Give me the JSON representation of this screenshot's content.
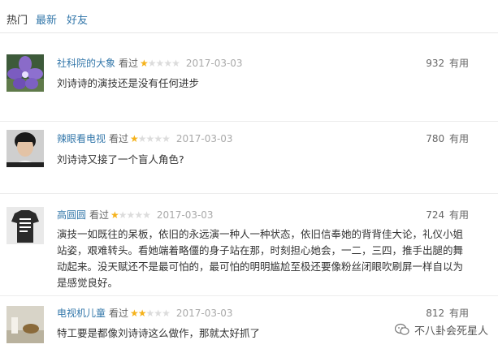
{
  "tabs": [
    {
      "label": "热门",
      "active": true
    },
    {
      "label": "最新",
      "active": false
    },
    {
      "label": "好友",
      "active": false
    }
  ],
  "comments": [
    {
      "user": "社科院的大象",
      "action": "看过",
      "rating": 1,
      "date": "2017-03-03",
      "votes": "932",
      "useful_label": "有用",
      "text": "刘诗诗的演技还是没有任何进步",
      "avatar": "flower-avatar"
    },
    {
      "user": "辣眼看电视",
      "action": "看过",
      "rating": 1,
      "date": "2017-03-03",
      "votes": "780",
      "useful_label": "有用",
      "text": "刘诗诗又接了一个盲人角色?",
      "avatar": "man-portrait-avatar"
    },
    {
      "user": "高圆圆",
      "action": "看过",
      "rating": 1,
      "date": "2017-03-03",
      "votes": "724",
      "useful_label": "有用",
      "text": "演技一如既往的呆板，依旧的永远演一种人一种状态，依旧信奉她的背背佳大论，礼仪小姐站姿，艰难转头。看她端着略僵的身子站在那，时刻担心她会，一二，三四，推手出腿的舞动起来。没天赋还不是最可怕的，最可怕的明明尴尬至极还要像粉丝闭眼吹刷屏一样自以为是感觉良好。",
      "avatar": "tshirt-avatar"
    },
    {
      "user": "电视机儿童",
      "action": "看过",
      "rating": 2,
      "date": "2017-03-03",
      "votes": "812",
      "useful_label": "有用",
      "text": "特工要是都像刘诗诗这么做作，那就太好抓了",
      "avatar": "still-life-avatar"
    }
  ],
  "watermark": {
    "text": "不八卦会死星人",
    "icon": "wechat-icon"
  },
  "colors": {
    "link": "#3377aa",
    "star": "#f5b21b",
    "star_empty": "#dcdcdc"
  }
}
